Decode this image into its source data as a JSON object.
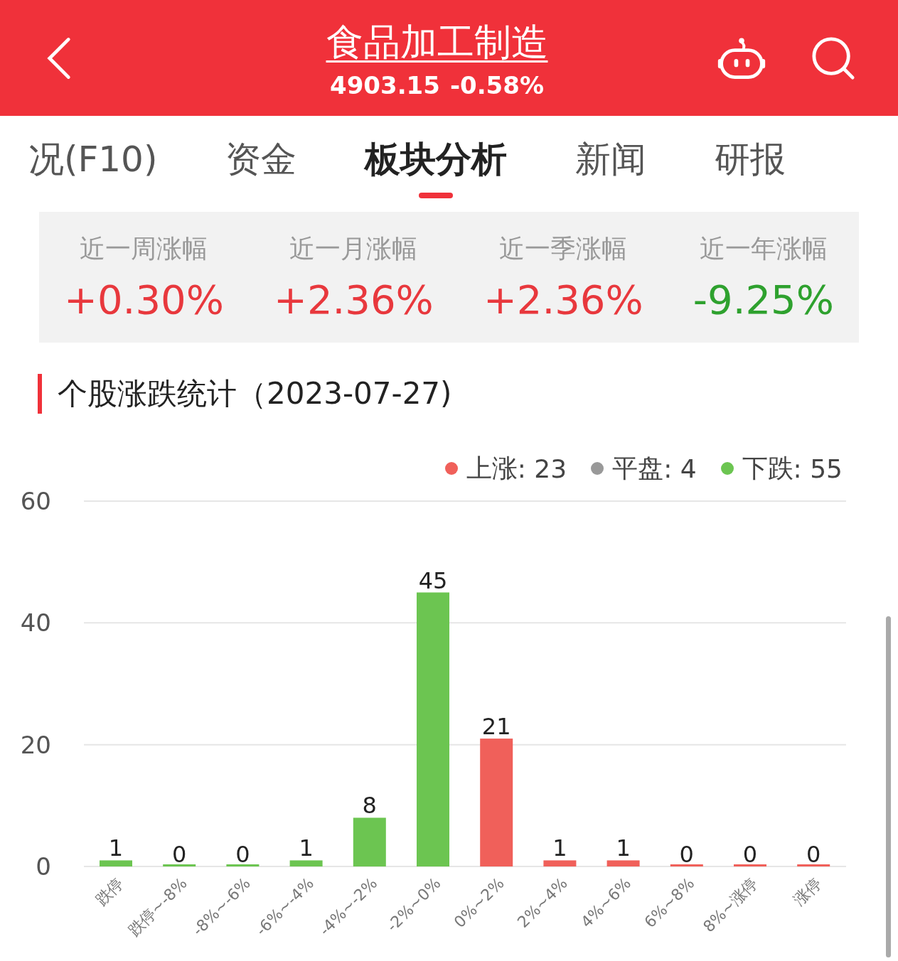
{
  "header": {
    "title": "食品加工制造",
    "price": "4903.15",
    "change": "-0.58%"
  },
  "tabs": [
    {
      "label": "况(F10)",
      "selected": false
    },
    {
      "label": "资金",
      "selected": false
    },
    {
      "label": "板块分析",
      "selected": true
    },
    {
      "label": "新闻",
      "selected": false
    },
    {
      "label": "研报",
      "selected": false
    }
  ],
  "period_stats": [
    {
      "label": "近一周涨幅",
      "value": "+0.30%",
      "color": "#e8383d"
    },
    {
      "label": "近一月涨幅",
      "value": "+2.36%",
      "color": "#e8383d"
    },
    {
      "label": "近一季涨幅",
      "value": "+2.36%",
      "color": "#e8383d"
    },
    {
      "label": "近一年涨幅",
      "value": "-9.25%",
      "color": "#2ea12e"
    }
  ],
  "section": {
    "title": "个股涨跌统计（2023-07-27)"
  },
  "legend_counts": [
    ": 23",
    ": 4",
    ": 55"
  ],
  "chart_data": {
    "type": "bar",
    "categories": [
      "跌停",
      "跌停~-8%",
      "-8%~-6%",
      "-6%~-4%",
      "-4%~-2%",
      "-2%~0%",
      "0%~2%",
      "2%~4%",
      "4%~6%",
      "6%~8%",
      "8%~涨停",
      "涨停"
    ],
    "series": [
      {
        "name": "上涨",
        "color": "#f0605a",
        "values": [
          null,
          null,
          null,
          null,
          null,
          null,
          21,
          1,
          1,
          0,
          0,
          0
        ]
      },
      {
        "name": "平盘",
        "color": "#999999",
        "values": [
          null,
          null,
          null,
          null,
          null,
          null,
          null,
          null,
          null,
          null,
          null,
          null
        ]
      },
      {
        "name": "下跌",
        "color": "#6cc551",
        "values": [
          1,
          0,
          0,
          1,
          8,
          45,
          null,
          null,
          null,
          null,
          null,
          null
        ]
      }
    ],
    "ylim": [
      0,
      60
    ],
    "yticks": [
      0,
      20,
      40,
      60
    ],
    "data_labels": true
  }
}
